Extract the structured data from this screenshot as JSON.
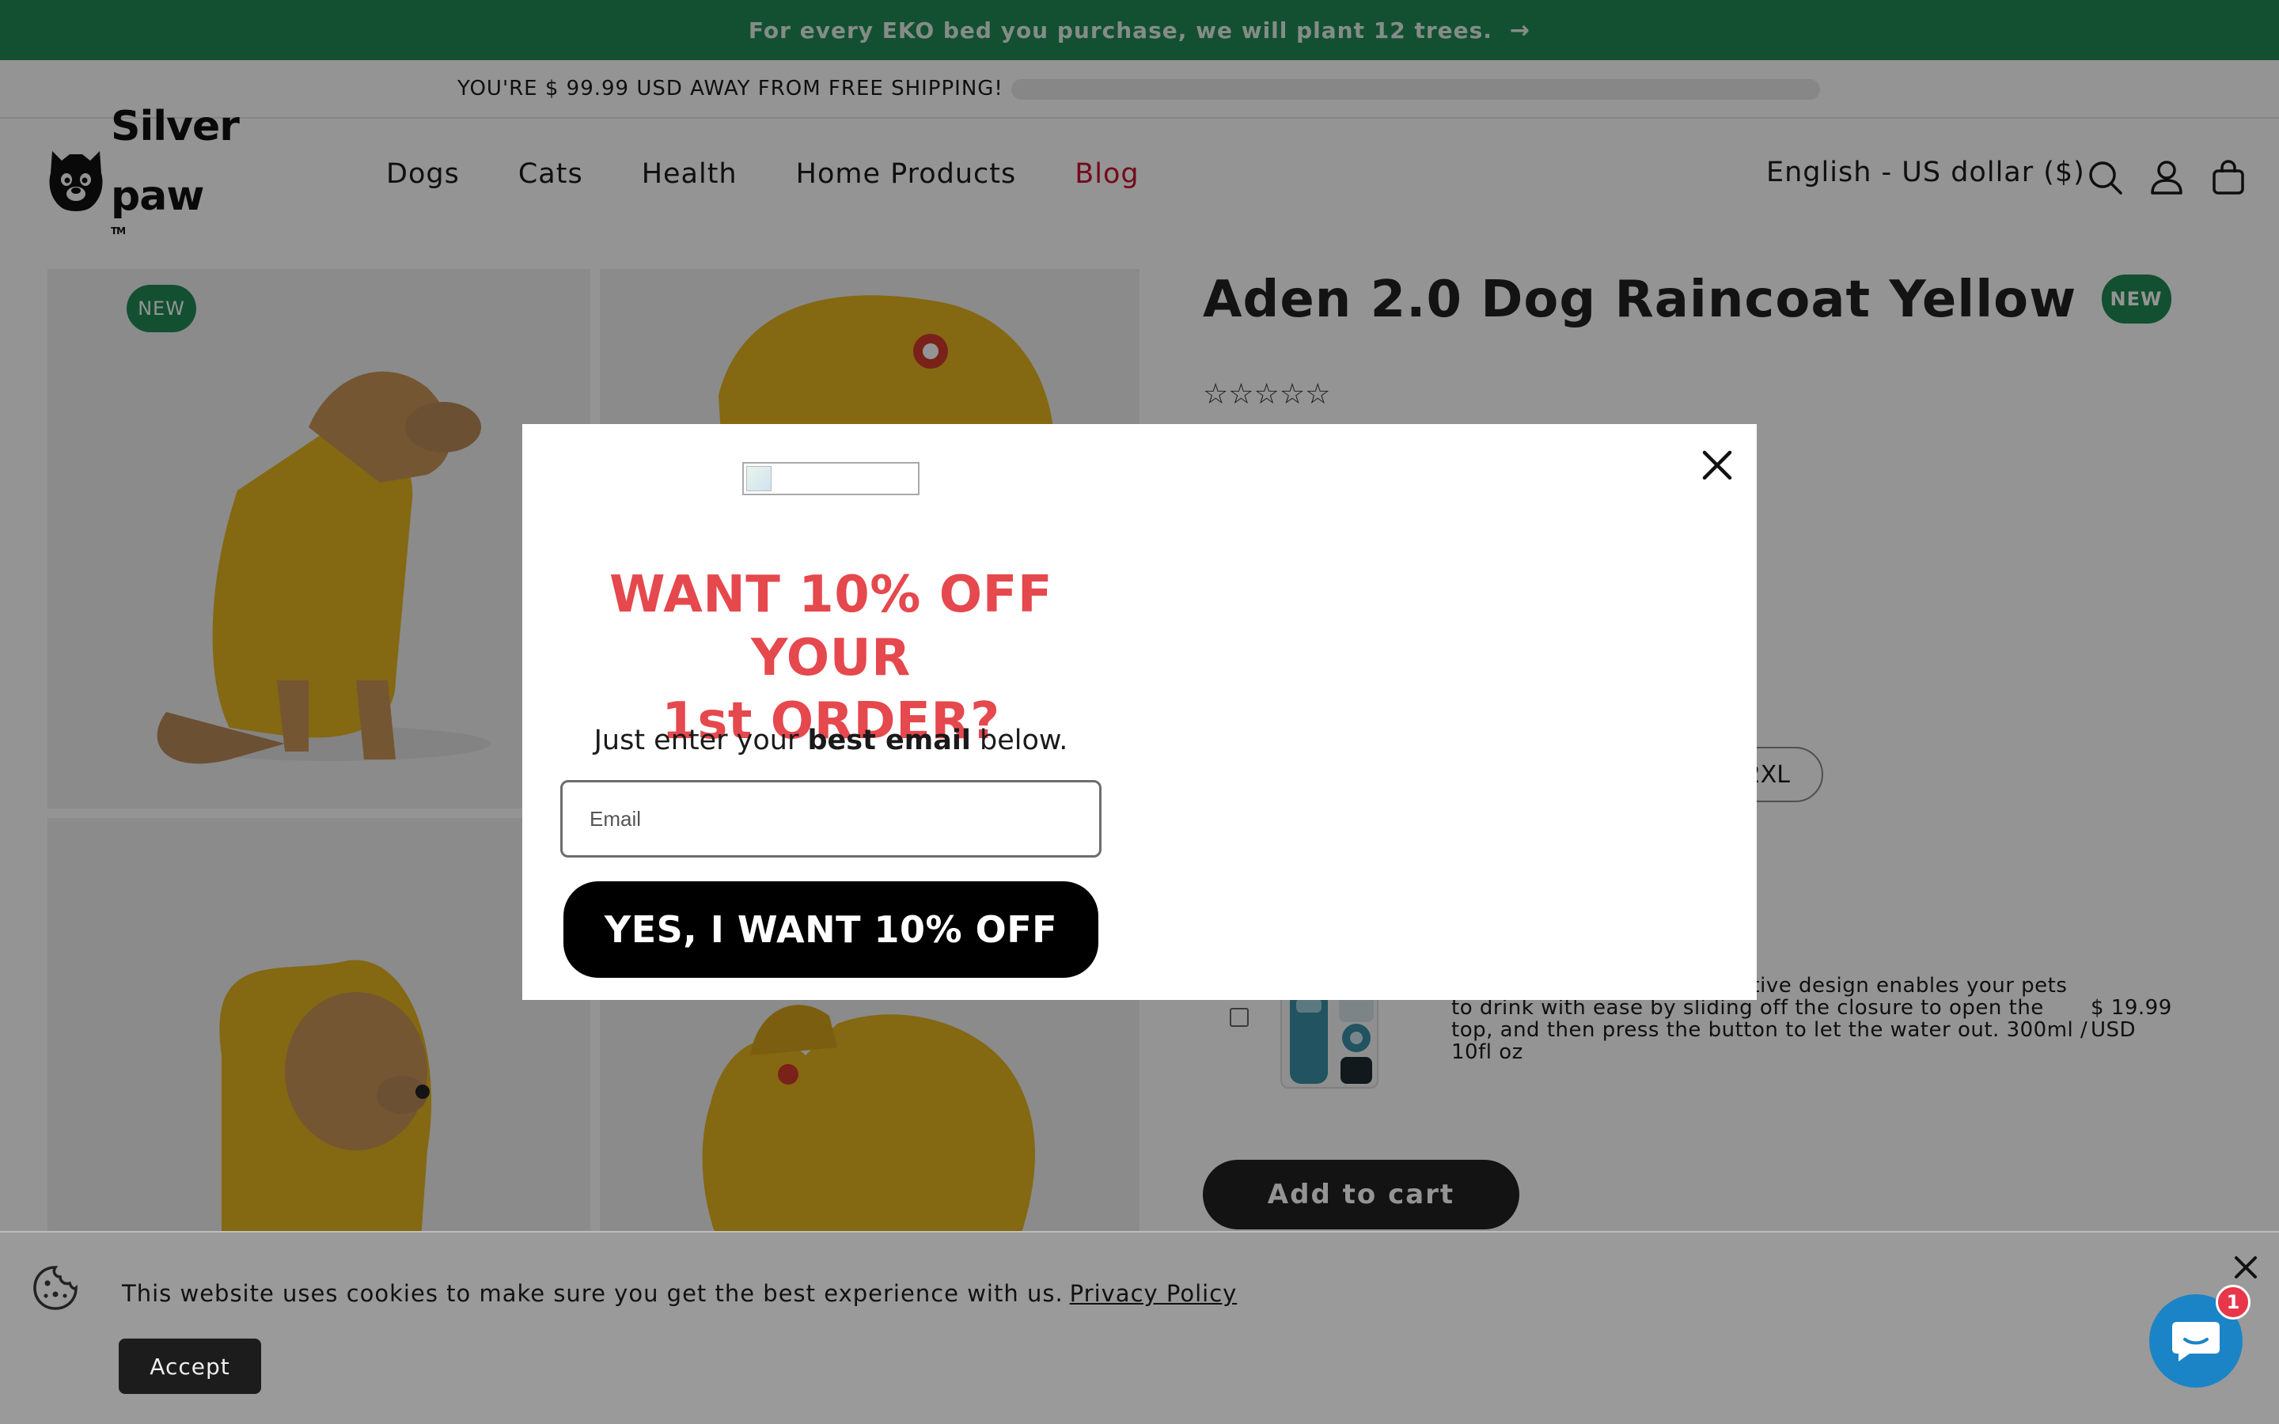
{
  "announcement": {
    "text": "For every EKO bed you purchase, we will plant 12 trees.",
    "arrow": "→"
  },
  "shipping": {
    "text": "YOU'RE $ 99.99 USD AWAY FROM FREE SHIPPING!",
    "progress": 0
  },
  "header": {
    "logo": {
      "line1": "Silver",
      "line2": "paw",
      "tm": "TM"
    },
    "nav": [
      {
        "label": "Dogs"
      },
      {
        "label": "Cats"
      },
      {
        "label": "Health"
      },
      {
        "label": "Home Products"
      },
      {
        "label": "Blog",
        "accent": "#c8102e"
      }
    ],
    "locale": "English - US dollar ($)",
    "icons": [
      "search-icon",
      "account-icon",
      "cart-icon"
    ]
  },
  "product": {
    "title": "Aden 2.0 Dog Raincoat Yellow",
    "title_badge": "NEW",
    "gallery_badge": "NEW",
    "rating": {
      "stars": "☆☆☆☆☆",
      "value": 0,
      "max": 5
    },
    "size_label": "2XL",
    "upsell": {
      "description": "h Charcoal Filter - Its innovative design enables your pets to drink with ease by sliding off the closure to open the top, and then press the button to let the water out. 300ml / 10fl oz",
      "price": "$ 19.99 USD",
      "checked": false
    },
    "add_to_cart": "Add to cart"
  },
  "popup": {
    "headline_line1": "WANT 10% OFF YOUR",
    "headline_line2": "1st ORDER?",
    "sub_pre": "Just enter your ",
    "sub_bold": "best email",
    "sub_post": " below.",
    "email_placeholder": "Email",
    "cta": "YES, I WANT 10% OFF",
    "headline_color": "#e5484d"
  },
  "cookie": {
    "text": "This website uses cookies to make sure you get the best experience with us.",
    "link": "Privacy Policy",
    "accept": "Accept"
  },
  "chat": {
    "badge": "1"
  },
  "colors": {
    "brand_green": "#1f8a55",
    "raincoat_yellow": "#e3b41f"
  }
}
